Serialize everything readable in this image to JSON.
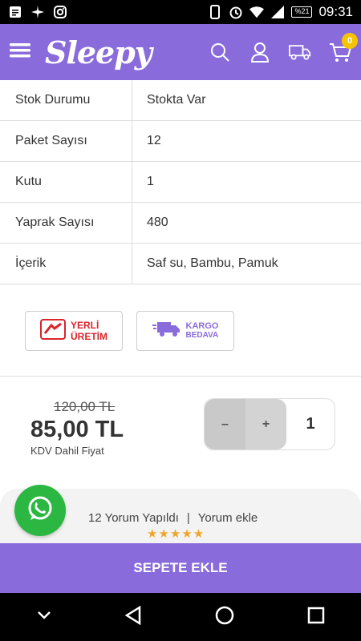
{
  "status_bar": {
    "time": "09:31",
    "battery": "%21"
  },
  "header": {
    "logo": "Sleepy",
    "cart_count": "0"
  },
  "specs": [
    {
      "key": "Stok Durumu",
      "value": "Stokta Var"
    },
    {
      "key": "Paket Sayısı",
      "value": "12"
    },
    {
      "key": "Kutu",
      "value": "1"
    },
    {
      "key": "Yaprak Sayısı",
      "value": "480"
    },
    {
      "key": "İçerik",
      "value": "Saf su, Bambu, Pamuk"
    }
  ],
  "badges": {
    "local": {
      "line1": "YERLİ",
      "line2": "ÜRETİM"
    },
    "shipping": {
      "line1": "KARGO",
      "line2": "BEDAVA"
    }
  },
  "price": {
    "old": "120,00 TL",
    "new": "85,00 TL",
    "note": "KDV Dahil Fiyat"
  },
  "quantity": {
    "minus": "–",
    "plus": "+",
    "value": "1"
  },
  "reviews": {
    "count_text": "12 Yorum Yapıldı",
    "separator": "|",
    "add_text": "Yorum ekle",
    "stars": "★★★★★"
  },
  "cta": {
    "add_to_cart": "SEPETE EKLE"
  },
  "colors": {
    "brand": "#8a6bdc",
    "whatsapp": "#2bb741",
    "star": "#f0a52a",
    "local_badge": "#d9262c"
  }
}
